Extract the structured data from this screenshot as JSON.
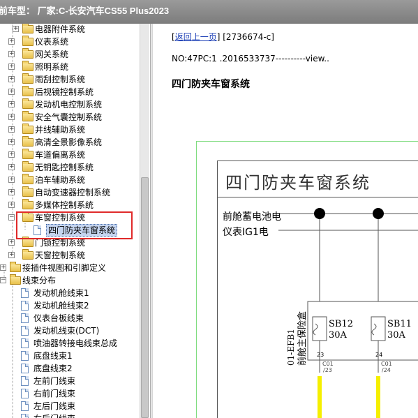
{
  "window": {
    "title": "前车型：  厂家:C-长安汽车CS55 Plus2023"
  },
  "tree": {
    "items": [
      {
        "label": "电器附件系统",
        "kind": "folder"
      },
      {
        "label": "仪表系统",
        "kind": "folder"
      },
      {
        "label": "网关系统",
        "kind": "folder"
      },
      {
        "label": "照明系统",
        "kind": "folder"
      },
      {
        "label": "雨刮控制系统",
        "kind": "folder"
      },
      {
        "label": "后视镜控制系统",
        "kind": "folder"
      },
      {
        "label": "发动机电控制系统",
        "kind": "folder"
      },
      {
        "label": "安全气囊控制系统",
        "kind": "folder"
      },
      {
        "label": "并线辅助系统",
        "kind": "folder"
      },
      {
        "label": "高清全景影像系统",
        "kind": "folder"
      },
      {
        "label": "车道偏离系统",
        "kind": "folder"
      },
      {
        "label": "无钥匙控制系统",
        "kind": "folder"
      },
      {
        "label": "泊车辅助系统",
        "kind": "folder"
      },
      {
        "label": "自动变速器控制系统",
        "kind": "folder"
      },
      {
        "label": "多媒体控制系统",
        "kind": "folder"
      },
      {
        "label": "车窗控制系统",
        "kind": "folder-open"
      },
      {
        "label": "四门防夹车窗系统",
        "kind": "doc-selected"
      },
      {
        "label": "门锁控制系统",
        "kind": "folder"
      },
      {
        "label": "天窗控制系统",
        "kind": "folder"
      },
      {
        "label": "接插件视图和引脚定义",
        "kind": "folder"
      },
      {
        "label": "线束分布",
        "kind": "folder-open"
      },
      {
        "label": "发动机舱线束1",
        "kind": "doc"
      },
      {
        "label": "发动机舱线束2",
        "kind": "doc"
      },
      {
        "label": "仪表台板线束",
        "kind": "doc"
      },
      {
        "label": "发动机线束(DCT)",
        "kind": "doc"
      },
      {
        "label": "喷油器转接电线束总成",
        "kind": "doc"
      },
      {
        "label": "底盘线束1",
        "kind": "doc"
      },
      {
        "label": "底盘线束2",
        "kind": "doc"
      },
      {
        "label": "左前门线束",
        "kind": "doc"
      },
      {
        "label": "右前门线束",
        "kind": "doc"
      },
      {
        "label": "左后门线束",
        "kind": "doc"
      },
      {
        "label": "右后门线束",
        "kind": "doc"
      }
    ]
  },
  "content": {
    "back_link": "返回上一页",
    "doc_id": "[2736674-c]",
    "no_line": "NO:47PC:1 .2016533737----------view..",
    "section_title": "四门防夹车窗系统"
  },
  "diagram": {
    "title": "四门防夹车窗系统",
    "power_rows": [
      "前舱蓄电池电",
      "仪表IG1电"
    ],
    "fuse_box_label": "01-EFB1\n前舱主保险盒",
    "fuses": [
      {
        "name": "SB12",
        "rating": "30A",
        "pin": "23",
        "conn": "C01",
        "conn_pin": "/23"
      },
      {
        "name": "SB11",
        "rating": "30A",
        "pin": "24",
        "conn": "C01",
        "conn_pin": "/24"
      }
    ]
  },
  "colors": {
    "highlight": "#e02a2a",
    "selection": "#c5d5f0",
    "wire": "#f5ef00",
    "frame": "#7fdc7f"
  }
}
